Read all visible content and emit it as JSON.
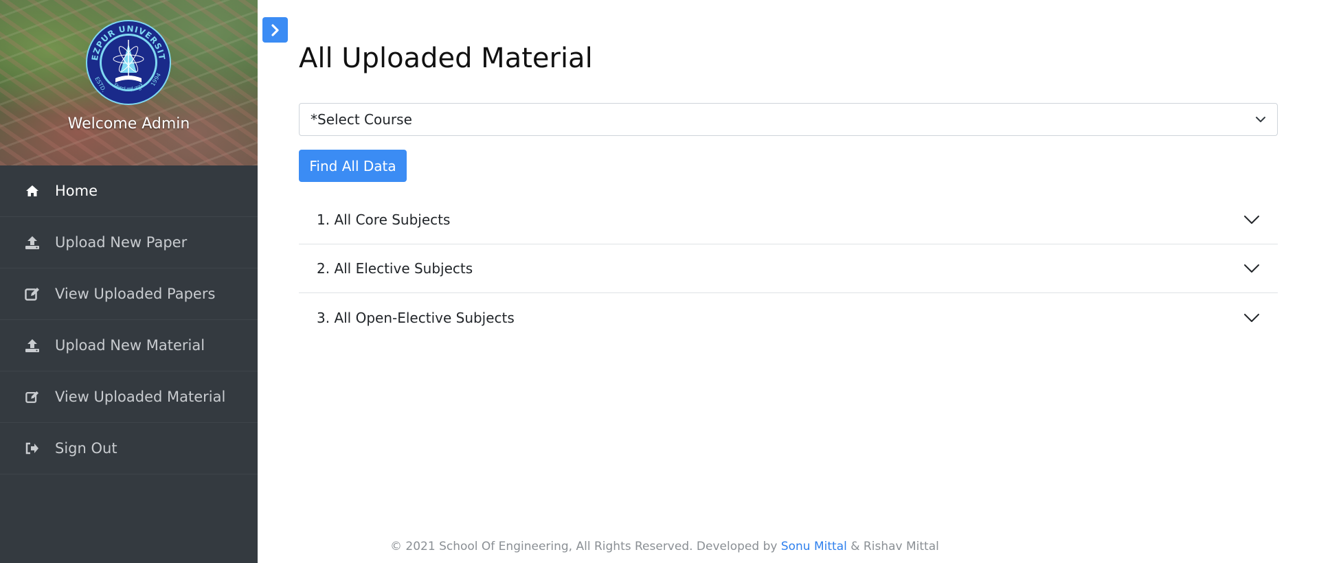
{
  "sidebar": {
    "logo": {
      "top_text": "TEZPUR UNIVERSITY",
      "estd": "ESTD.",
      "year": "1994",
      "motto": "विज्ञानं यज्ञं तनुते"
    },
    "welcome": "Welcome Admin",
    "items": [
      {
        "label": "Home",
        "icon": "home-icon",
        "active": true
      },
      {
        "label": "Upload New Paper",
        "icon": "upload-icon"
      },
      {
        "label": "View Uploaded Papers",
        "icon": "edit-icon"
      },
      {
        "label": "Upload New Material",
        "icon": "upload-icon"
      },
      {
        "label": "View Uploaded Material",
        "icon": "edit-icon"
      },
      {
        "label": "Sign Out",
        "icon": "sign-out-icon"
      }
    ]
  },
  "toggle": {
    "icon": "chevron-right-icon"
  },
  "main": {
    "title": "All Uploaded Material",
    "select": {
      "value": "*Select Course"
    },
    "find_button": "Find All Data",
    "accordion": [
      {
        "label": "1. All Core Subjects"
      },
      {
        "label": "2. All Elective Subjects"
      },
      {
        "label": "3. All Open-Elective Subjects"
      }
    ]
  },
  "footer": {
    "prefix": "© 2021 School Of Engineering, All Rights Reserved. Developed by",
    "author1": "Sonu Mittal",
    "amp": "&",
    "author2": "Rishav Mittal"
  },
  "colors": {
    "sidebar_bg": "#343a40",
    "accent": "#3b8cf4",
    "link": "#2f80ed",
    "logo_blue": "#1a2a8a",
    "logo_ring": "#7fd8f2"
  }
}
